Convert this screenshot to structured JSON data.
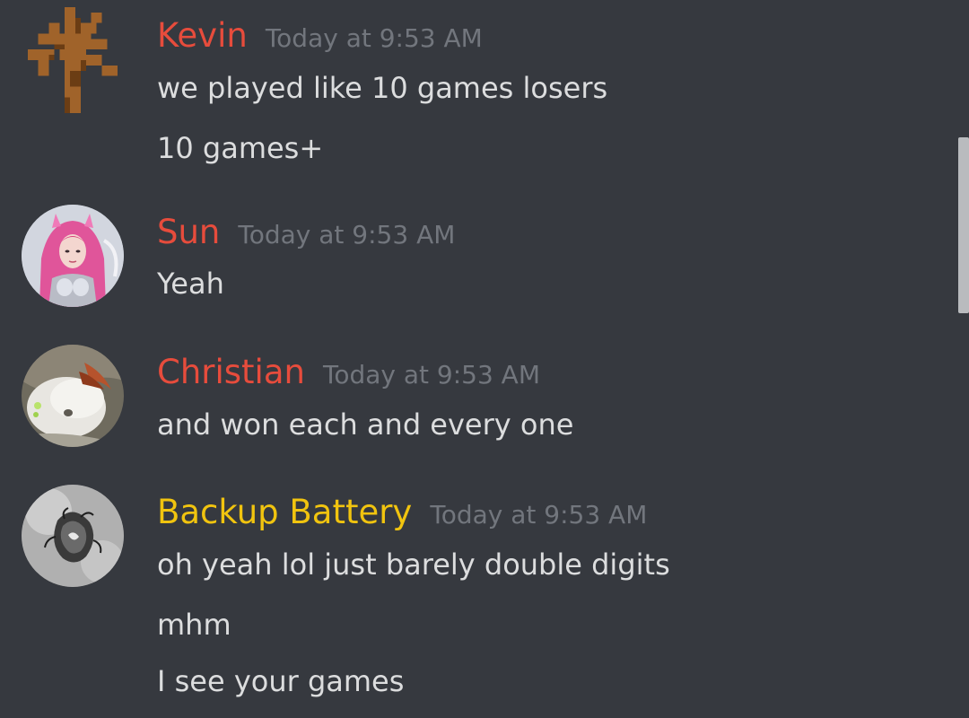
{
  "messages": [
    {
      "username": "Kevin",
      "name_color": "#e74c3c",
      "timestamp": "Today at 9:53 AM",
      "avatar": "pixel-tree-avatar",
      "lines": [
        "we played like 10 games losers",
        "10 games+"
      ]
    },
    {
      "username": "Sun",
      "name_color": "#e74c3c",
      "timestamp": "Today at 9:53 AM",
      "avatar": "pink-hair-character-avatar",
      "lines": [
        "Yeah"
      ]
    },
    {
      "username": "Christian",
      "name_color": "#e74c3c",
      "timestamp": "Today at 9:53 AM",
      "avatar": "white-creature-avatar",
      "lines": [
        "and won each and every one"
      ]
    },
    {
      "username": "Backup Battery",
      "name_color": "#f1c40f",
      "timestamp": "Today at 9:53 AM",
      "avatar": "grayscale-art-avatar",
      "lines": [
        "oh yeah lol just barely double digits",
        "mhm",
        "I see your games"
      ]
    }
  ],
  "colors": {
    "background": "#36393f",
    "message_text": "#dcddde",
    "timestamp": "#72767d",
    "scrollbar": "#b9bbbe"
  }
}
